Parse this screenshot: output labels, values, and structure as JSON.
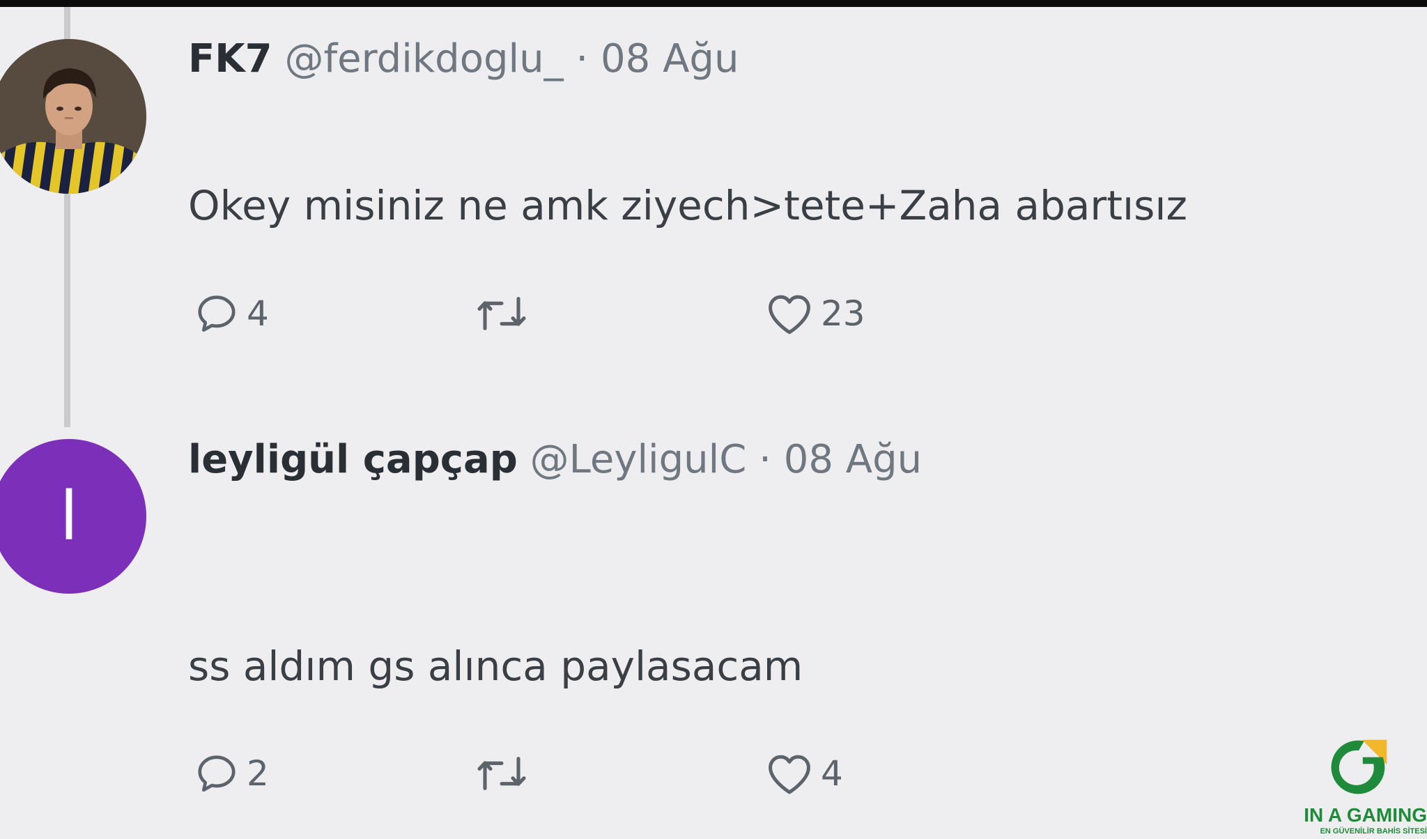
{
  "tweets": [
    {
      "display_name": "FK7",
      "handle": "@ferdikdoglu_",
      "separator": "·",
      "date": "08 Ağu",
      "text": "Okey misiniz ne amk ziyech>tete+Zaha abartısız",
      "reply_count": "4",
      "like_count": "23",
      "avatar": "player-photo"
    },
    {
      "display_name": "leyligül çapçap",
      "handle": "@LeyligulC",
      "separator": "·",
      "date": "08 Ağu",
      "text": "ss aldım gs alınca paylasacam",
      "reply_count": "2",
      "like_count": "4",
      "avatar_letter": "l",
      "avatar_color": "#7c2fb8"
    }
  ],
  "icons": {
    "reply": "reply-icon",
    "retweet": "retweet-icon",
    "like": "heart-icon"
  },
  "watermark": {
    "title": "IN A GAMING",
    "subtitle": "EN GÜVENİLİR BAHİS SİTESİ",
    "colors": {
      "green": "#1f8a3a",
      "yellow": "#f2b72a"
    }
  }
}
